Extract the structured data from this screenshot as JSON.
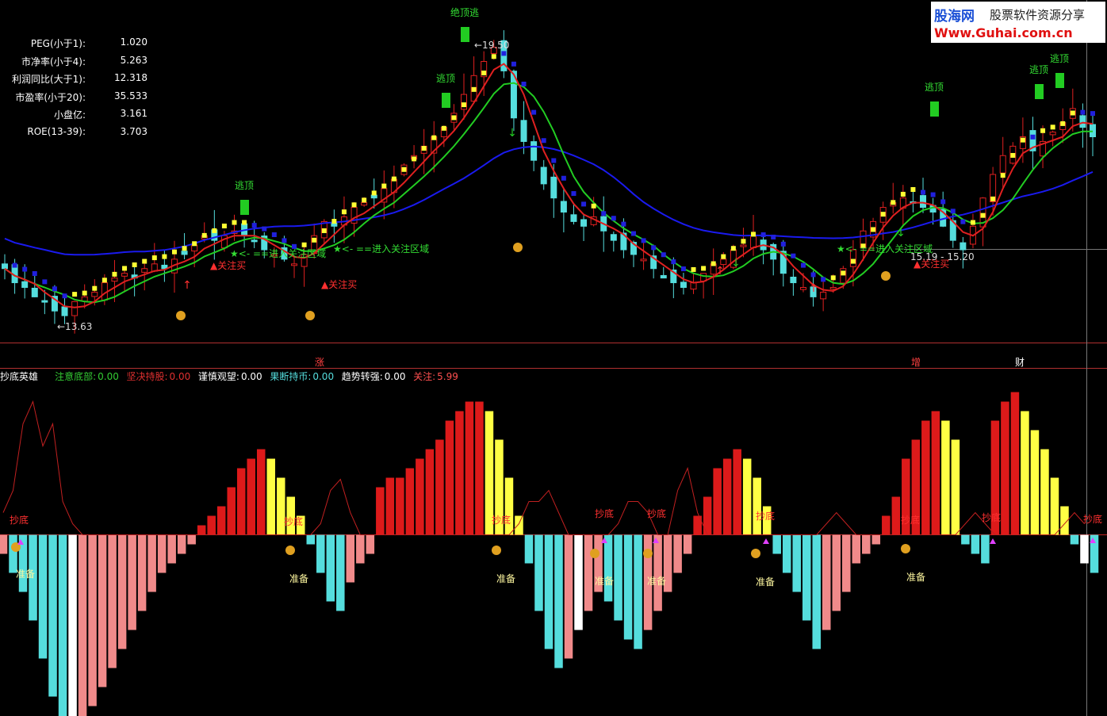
{
  "watermark": {
    "brand": "股海网",
    "slogan": "股票软件资源分享",
    "url": "Www.Guhai.com.cn"
  },
  "info_panel": [
    {
      "label": "PEG(小于1):",
      "value": "1.020"
    },
    {
      "label": "市净率(小于4):",
      "value": "5.263"
    },
    {
      "label": "利润同比(大于1):",
      "value": "12.318"
    },
    {
      "label": "市盈率(小于20):",
      "value": "35.533"
    },
    {
      "label": "小盘亿:",
      "value": "3.161"
    },
    {
      "label": "ROE(13-39):",
      "value": "3.703"
    }
  ],
  "indicator_legend": {
    "name": "抄底英雄",
    "items": [
      {
        "label": "注意底部:",
        "value": "0.00",
        "color": "#33cc33"
      },
      {
        "label": "坚决持股:",
        "value": "0.00",
        "color": "#e03030"
      },
      {
        "label": "谨慎观望:",
        "value": "0.00",
        "color": "#ffffff"
      },
      {
        "label": "果断持币:",
        "value": "0.00",
        "color": "#55dddd"
      },
      {
        "label": "趋势转强:",
        "value": "0.00",
        "color": "#ffffff"
      },
      {
        "label": "关注:",
        "value": "5.99",
        "color": "#ff5050"
      }
    ]
  },
  "colors": {
    "up": "#e02020",
    "down": "#55dddd",
    "ma_short": "#e02020",
    "ma_mid": "#22cc22",
    "ma_long": "#1a1aee",
    "trail_up": "#ffff33",
    "trail_down": "#2020dd",
    "hist_red": "#dd1a1a",
    "hist_yellow": "#ffff44",
    "hist_cyan": "#55dddd",
    "hist_pink": "#f08a8a",
    "hist_white": "#ffffff"
  },
  "chart_data": [
    {
      "type": "candlestick",
      "title": "",
      "series": [
        {
          "name": "close",
          "values": [
            14.6,
            14.3,
            14.2,
            14.0,
            13.9,
            13.7,
            13.6,
            13.9,
            14.0,
            14.1,
            14.3,
            14.4,
            14.5,
            14.4,
            14.6,
            14.7,
            14.6,
            14.8,
            14.9,
            15.1,
            15.3,
            15.2,
            15.3,
            15.4,
            15.3,
            15.2,
            15.0,
            14.9,
            14.8,
            14.7,
            14.9,
            15.3,
            15.6,
            15.5,
            15.7,
            15.9,
            16.0,
            16.1,
            16.3,
            16.5,
            16.8,
            17.0,
            17.2,
            17.4,
            17.6,
            17.9,
            18.3,
            18.7,
            19.0,
            19.3,
            18.8,
            17.8,
            17.3,
            16.9,
            16.4,
            16.1,
            15.8,
            15.6,
            15.5,
            15.7,
            15.4,
            15.2,
            15.0,
            14.9,
            14.8,
            14.6,
            14.4,
            14.3,
            14.2,
            14.3,
            14.5,
            14.7,
            14.8,
            15.0,
            15.1,
            15.3,
            15.0,
            14.8,
            14.5,
            14.3,
            14.2,
            14.0,
            14.1,
            14.2,
            14.6,
            15.0,
            15.4,
            15.6,
            15.9,
            16.0,
            16.1,
            16.0,
            15.9,
            15.8,
            15.5,
            15.2,
            15.0,
            15.5,
            16.1,
            16.6,
            17.0,
            17.2,
            17.4,
            17.1,
            17.3,
            17.5,
            17.7,
            18.0,
            17.6,
            17.4
          ]
        }
      ],
      "price_labels": [
        "19.50",
        "13.63",
        "15.19 - 15.20"
      ],
      "annotations": [
        "逃顶",
        "绝顶逃",
        "逃顶",
        "逃顶",
        "逃顶",
        "逃顶",
        "★<- ==进入关注区域",
        "★<- ==进入关注区域",
        "★<- ==进入关注区域",
        "▲关注买",
        "▲关注买",
        "▲关注买"
      ],
      "event_markers": [
        "涨",
        "增",
        "财"
      ]
    },
    {
      "type": "bar",
      "title": "抄底英雄",
      "series": [
        {
          "name": "抄底英雄",
          "values": [
            -2,
            -4,
            -6,
            -9,
            -13,
            -17,
            -20,
            -21,
            -20,
            -18,
            -16,
            -14,
            -12,
            -10,
            -8,
            -6,
            -4,
            -3,
            -2,
            -1,
            1,
            2,
            3,
            5,
            7,
            8,
            9,
            8,
            6,
            4,
            2,
            -1,
            -4,
            -7,
            -8,
            -5,
            -3,
            -2,
            5,
            6,
            6,
            7,
            8,
            9,
            10,
            12,
            13,
            14,
            14,
            13,
            10,
            6,
            2,
            -3,
            -8,
            -12,
            -14,
            -13,
            -10,
            -8,
            -6,
            -7,
            -9,
            -11,
            -12,
            -10,
            -8,
            -6,
            -4,
            -2,
            2,
            4,
            7,
            8,
            9,
            8,
            6,
            3,
            -2,
            -4,
            -6,
            -9,
            -12,
            -10,
            -8,
            -6,
            -3,
            -2,
            -1,
            2,
            4,
            8,
            10,
            12,
            13,
            12,
            10,
            -1,
            -2,
            -3,
            12,
            14,
            15,
            13,
            11,
            9,
            6,
            3,
            -1,
            -3,
            -4
          ]
        },
        {
          "name": "抄底",
          "values": [
            2,
            4,
            10,
            12,
            8,
            10,
            3,
            1,
            0,
            0,
            0,
            0,
            0,
            0,
            0,
            0,
            0,
            0,
            0,
            0,
            0,
            0,
            0,
            0,
            0,
            0,
            0,
            0,
            0,
            0,
            0,
            0,
            1,
            4,
            5,
            2,
            0,
            0,
            0,
            0,
            0,
            0,
            0,
            0,
            0,
            0,
            0,
            0,
            0,
            0,
            0,
            0,
            1,
            3,
            3,
            4,
            2,
            0,
            0,
            0,
            0,
            0,
            1,
            3,
            3,
            2,
            0,
            0,
            4,
            6,
            2,
            0,
            0,
            0,
            0,
            0,
            0,
            0,
            0,
            0,
            0,
            0,
            0,
            1,
            2,
            1,
            0,
            0,
            0,
            0,
            0,
            0,
            0,
            0,
            0,
            0,
            0,
            1,
            2,
            1,
            0,
            0,
            0,
            0,
            0,
            0,
            0,
            1,
            2,
            1
          ]
        }
      ],
      "labels": [
        "抄底",
        "抄底",
        "抄底",
        "抄底",
        "抄底",
        "抄底",
        "抄底",
        "抄底",
        "抄底",
        "准备",
        "准备",
        "准备",
        "准备",
        "准备",
        "准备",
        "准备",
        "准备"
      ]
    }
  ]
}
